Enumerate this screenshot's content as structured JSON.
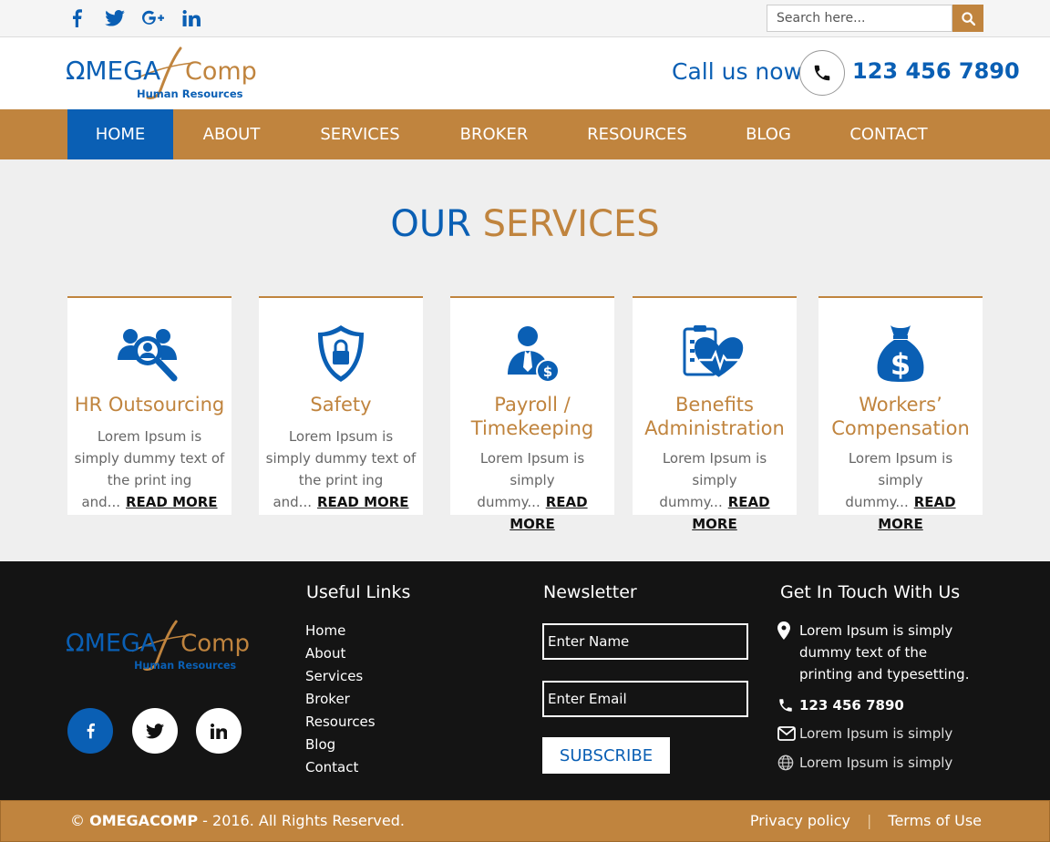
{
  "topbar": {
    "social": [
      "facebook-icon",
      "twitter-icon",
      "google-plus-icon",
      "linkedin-icon"
    ],
    "search_placeholder": "Search here..."
  },
  "header": {
    "logo_text_1": "ΩMEGA",
    "logo_text_2": "Comp",
    "logo_sub": "Human Resources",
    "call_label": "Call us now",
    "phone": "123 456 7890"
  },
  "nav": {
    "items": [
      "HOME",
      "ABOUT",
      "SERVICES",
      "BROKER",
      "RESOURCES",
      "BLOG",
      "CONTACT"
    ],
    "active": "HOME"
  },
  "services": {
    "title_1": "OUR",
    "title_2": "SERVICES",
    "cards": [
      {
        "icon": "hr-search-icon",
        "title": "HR Outsourcing",
        "text": "Lorem Ipsum is simply dummy text of the print ing and...",
        "link": "READ MORE"
      },
      {
        "icon": "shield-lock-icon",
        "title": "Safety",
        "text": "Lorem Ipsum is simply dummy text of the print ing and...",
        "link": "READ MORE"
      },
      {
        "icon": "payroll-person-icon",
        "title": "Payroll / Timekeeping",
        "text": "Lorem Ipsum is simply dummy...",
        "link": "READ MORE"
      },
      {
        "icon": "benefits-clipboard-icon",
        "title": "Benefits Administration",
        "text": "Lorem Ipsum is simply dummy...",
        "link": "READ MORE"
      },
      {
        "icon": "money-bag-icon",
        "title": "Workers’ Compensation",
        "text": "Lorem Ipsum is simply dummy...",
        "link": "READ MORE"
      }
    ]
  },
  "footer": {
    "useful_links_title": "Useful Links",
    "links": [
      "Home",
      "About",
      "Services",
      "Broker",
      "Resources",
      "Blog",
      "Contact"
    ],
    "newsletter_title": "Newsletter",
    "name_placeholder": "Enter Name",
    "email_placeholder": "Enter Email",
    "subscribe_label": "SUBSCRIBE",
    "contact_title": "Get In Touch With Us",
    "address": "Lorem Ipsum is simply dummy text of the printing and typesetting.",
    "phone": "123 456 7890",
    "email": "Lorem Ipsum is simply",
    "web": "Lorem Ipsum is simply"
  },
  "bottom": {
    "copy_symbol": "©",
    "brand": "OMEGACOMP",
    "copy_rest": "- 2016. All Rights Reserved.",
    "privacy": "Privacy policy",
    "separator": "|",
    "terms": "Terms of Use"
  },
  "colors": {
    "blue": "#0a5fb4",
    "gold": "#c0843e",
    "footer_bg": "#141414"
  }
}
